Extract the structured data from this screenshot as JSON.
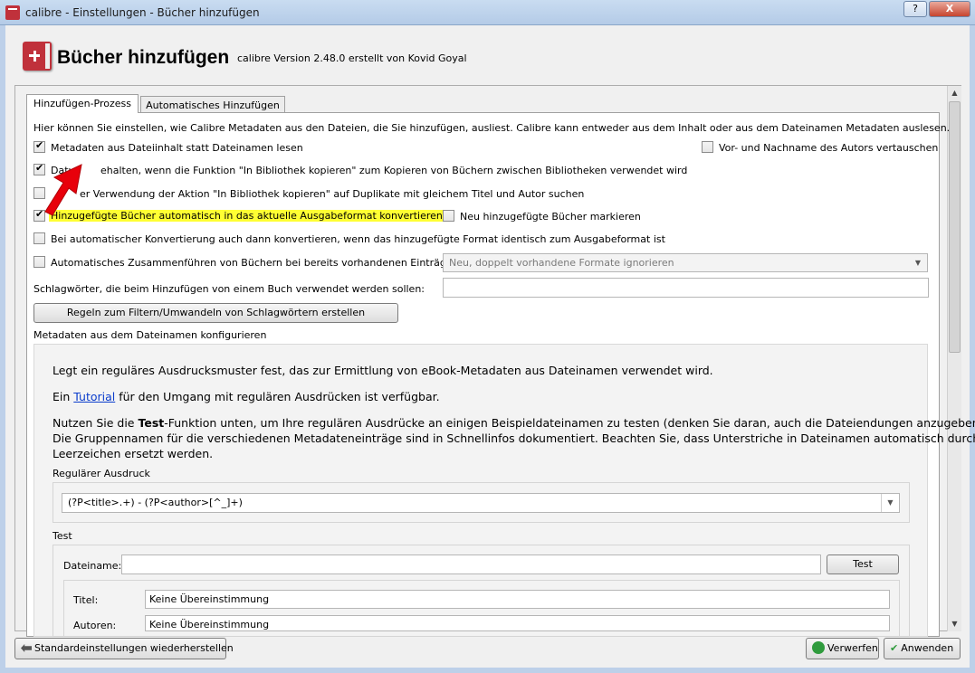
{
  "window": {
    "title": "calibre - Einstellungen - Bücher hinzufügen",
    "help_button": "?",
    "close_button": "X"
  },
  "header": {
    "title": "Bücher hinzufügen",
    "version": "calibre Version 2.48.0 erstellt von Kovid Goyal"
  },
  "tabs": [
    {
      "label": "Hinzufügen-Prozess",
      "active": true
    },
    {
      "label": "Automatisches Hinzufügen",
      "active": false
    }
  ],
  "intro": "Hier können Sie einstellen, wie Calibre Metadaten aus den Dateien, die Sie hinzufügen, ausliest. Calibre kann entweder aus dem Inhalt oder aus dem Dateinamen Metadaten auslesen.",
  "options": {
    "read_metadata": {
      "label": "Metadaten aus Dateiinhalt statt Dateinamen lesen",
      "checked": true
    },
    "swap_author": {
      "label": "Vor- und Nachname des Autors vertauschen",
      "checked": false
    },
    "preserve_dates_pre": "Datu",
    "preserve_dates": {
      "label": "ehalten, wenn die Funktion \"In Bibliothek kopieren\" zum Kopieren von Büchern zwischen Bibliotheken verwendet wird",
      "checked": true
    },
    "check_dupes": {
      "label": "er Verwendung der Aktion \"In Bibliothek kopieren\" auf Duplikate mit gleichem Titel und Autor suchen",
      "checked": false
    },
    "auto_convert": {
      "label": "Hinzugefügte Bücher automatisch in das aktuelle Ausgabeformat konvertieren",
      "checked": true
    },
    "mark_new": {
      "label": "Neu hinzugefügte Bücher markieren",
      "checked": false
    },
    "convert_same": {
      "label": "Bei automatischer Konvertierung auch dann konvertieren, wenn das hinzugefügte Format identisch zum Ausgabeformat ist",
      "checked": false
    },
    "auto_merge": {
      "label": "Automatisches Zusammenführen von Büchern bei bereits vorhandenen Einträgen:",
      "checked": false
    },
    "auto_merge_select": "Neu, doppelt vorhandene Formate ignorieren"
  },
  "tags": {
    "label": "Schlagwörter, die beim Hinzufügen von einem Buch verwendet werden sollen:",
    "value": "",
    "rules_button": "Regeln zum Filtern/Umwandeln von Schlagwörtern erstellen"
  },
  "filename_section": {
    "title": "Metadaten aus dem Dateinamen konfigurieren",
    "p1": "Legt ein reguläres Ausdrucksmuster fest, das zur Ermittlung von eBook-Metadaten aus Dateinamen verwendet wird.",
    "p2_pre": "Ein ",
    "p2_link": "Tutorial",
    "p2_post": " für den Umgang mit regulären Ausdrücken ist verfügbar.",
    "p3_pre": "Nutzen Sie die ",
    "p3_bold": "Test",
    "p3_line1_post": "-Funktion unten, um Ihre regulären Ausdrücke an einigen Beispieldateinamen zu testen (denken Sie daran, auch die Dateiendungen anzugeben).",
    "p3_line2": "Die Gruppennamen für die verschiedenen Metadateneinträge sind in Schnellinfos dokumentiert. Beachten Sie, dass Unterstriche in Dateinamen automatisch durch",
    "p3_line3": "Leerzeichen ersetzt werden.",
    "regex_label": "Regulärer Ausdruck",
    "regex_value": "(?P<title>.+) - (?P<author>[^_]+)",
    "test_label": "Test",
    "filename_label": "Dateiname:",
    "filename_value": "",
    "test_button": "Test",
    "title_label": "Titel:",
    "title_value": "Keine Übereinstimmung",
    "authors_label": "Autoren:",
    "authors_value": "Keine Übereinstimmung"
  },
  "footer": {
    "reset": "Standardeinstellungen wiederherstellen",
    "discard": "Verwerfen",
    "apply": "Anwenden"
  },
  "colors": {
    "highlight": "#ffff33",
    "arrow": "#e8000b",
    "link": "#0a3ccc"
  }
}
